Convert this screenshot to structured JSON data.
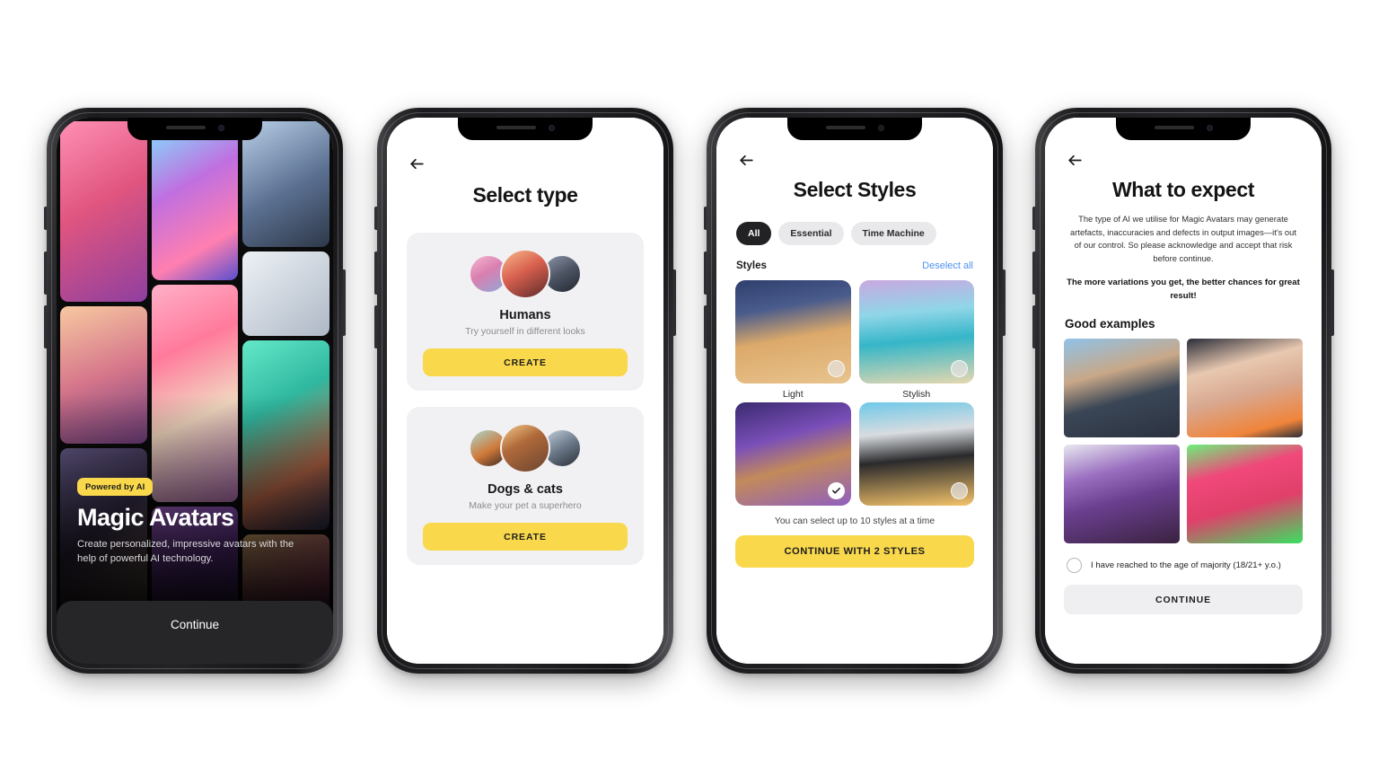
{
  "phone1": {
    "name": "onboarding-hero",
    "badge": "Powered by AI",
    "title": "Magic Avatars",
    "subtitle": "Create personalized, impressive avatars with the help of powerful AI technology.",
    "cta": "Continue",
    "accent": "#F9D84B",
    "cta_bg": "#262628"
  },
  "phone2": {
    "name": "select-type",
    "back": "←",
    "title": "Select type",
    "cards": [
      {
        "heading": "Humans",
        "subtext": "Try yourself in different looks",
        "button": "CREATE"
      },
      {
        "heading": "Dogs & cats",
        "subtext": "Make your pet a superhero",
        "button": "CREATE"
      }
    ],
    "accent": "#F9D84B",
    "card_bg": "#F1F1F3"
  },
  "phone3": {
    "name": "select-styles",
    "back": "←",
    "title": "Select Styles",
    "filters": [
      {
        "label": "All",
        "active": true
      },
      {
        "label": "Essential",
        "active": false
      },
      {
        "label": "Time Machine",
        "active": false
      }
    ],
    "section_label": "Styles",
    "deselect_all": "Deselect all",
    "styles": [
      {
        "caption": "Light",
        "selected": false
      },
      {
        "caption": "Stylish",
        "selected": false
      },
      {
        "caption": "",
        "selected": true
      },
      {
        "caption": "",
        "selected": false
      }
    ],
    "hint": "You can select up to 10 styles at a time",
    "cta": "CONTINUE WITH 2 STYLES",
    "selected_count": 2,
    "max_styles": 10,
    "accent": "#F9D84B",
    "link_color": "#4D93F5"
  },
  "phone4": {
    "name": "what-to-expect",
    "back": "←",
    "title": "What to expect",
    "body": "The type of AI we utilise for Magic Avatars may generate artefacts, inaccuracies and defects in output images—it's out of our control. So please acknowledge and accept that risk before continue.",
    "emphasis": "The more variations you get, the better chances for great result!",
    "examples_heading": "Good examples",
    "age_label": "I have reached to the age of majority (18/21+ y.o.)",
    "age_checked": false,
    "cta": "CONTINUE",
    "cta_bg": "#EFEFF1"
  }
}
